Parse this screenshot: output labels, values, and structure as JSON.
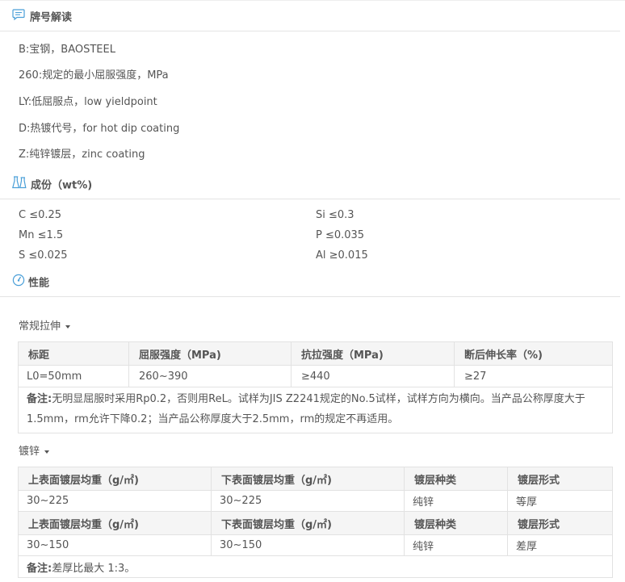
{
  "sections": {
    "grade": {
      "title": "牌号解读",
      "icon": "comment-icon"
    },
    "composition": {
      "title": "成份（wt%)",
      "icon": "flask-icon"
    },
    "properties": {
      "title": "性能",
      "icon": "gauge-icon"
    }
  },
  "grade_lines": [
    "B:宝钢，BAOSTEEL",
    "260:规定的最小屈服强度，MPa",
    "LY:低屈服点，low yieldpoint",
    "D:热镀代号，for hot dip coating",
    "Z:纯锌镀层，zinc coating"
  ],
  "composition": [
    {
      "left": "C ≤0.25",
      "right": "Si ≤0.3"
    },
    {
      "left": "Mn ≤1.5",
      "right": "P ≤0.035"
    },
    {
      "left": "S ≤0.025",
      "right": "Al ≥0.015"
    }
  ],
  "tensile": {
    "dropdown": "常规拉伸",
    "headers": [
      "标距",
      "屈服强度（MPa)",
      "抗拉强度（MPa)",
      "断后伸长率（%)"
    ],
    "row": [
      "L0=50mm",
      "260~390",
      "≥440",
      "≥27"
    ],
    "note_label": "备注:",
    "note_text": "无明显屈服时采用Rp0.2，否则用ReL。试样为JIS Z2241规定的No.5试样，试样方向为横向。当产品公称厚度大于1.5mm，rm允许下降0.2；当产品公称厚度大于2.5mm，rm的规定不再适用。"
  },
  "galvanize": {
    "dropdown": "镀锌",
    "headers": [
      "上表面镀层均重（g/㎡)",
      "下表面镀层均重（g/㎡)",
      "镀层种类",
      "镀层形式"
    ],
    "row1": [
      "30~225",
      "30~225",
      "纯锌",
      "等厚"
    ],
    "row2": [
      "30~150",
      "30~150",
      "纯锌",
      "差厚"
    ],
    "note_label": "备注:",
    "note_text": "差厚比最大 1:3。"
  }
}
